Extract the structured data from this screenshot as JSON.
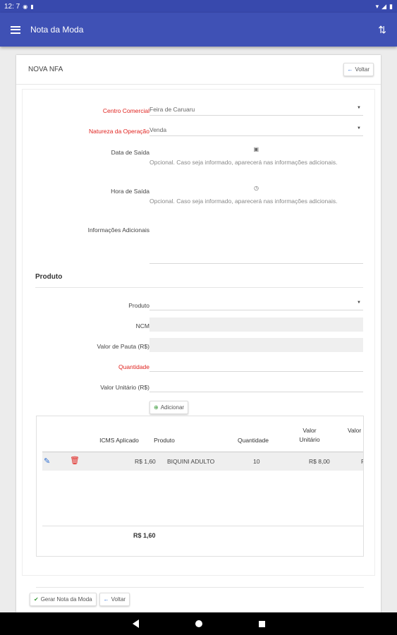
{
  "status": {
    "time": "12: 7"
  },
  "appbar": {
    "title": "Nota da Moda"
  },
  "card": {
    "title": "NOVA NFA",
    "back_label": "Voltar"
  },
  "form": {
    "centro_label": "Centro Comercial",
    "centro_value": "Feira de Caruaru",
    "natureza_label": "Natureza da Operação",
    "natureza_value": "Venda",
    "data_label": "Data de Saída",
    "data_help": "Opcional. Caso seja informado, aparecerá nas informações adicionais.",
    "hora_label": "Hora de Saída",
    "hora_help": "Opcional. Caso seja informado, aparecerá nas informações adicionais.",
    "info_label": "Informações Adicionais"
  },
  "produto_section": {
    "title": "Produto",
    "produto_label": "Produto",
    "ncm_label": "NCM",
    "pauta_label": "Valor de Pauta (R$)",
    "quantidade_label": "Quantidade",
    "unitario_label": "Valor Unitário (R$)",
    "add_label": "Adicionar"
  },
  "table": {
    "headers": [
      "ICMS Aplicado",
      "Produto",
      "Quantidade",
      "Valor Unitário",
      "Valor Pa"
    ],
    "rows": [
      {
        "icms": "R$ 1,60",
        "produto": "BIQUINI ADULTO",
        "quantidade": "10",
        "unitario": "R$ 8,00",
        "partial": "F"
      }
    ],
    "total": "R$ 1,60"
  },
  "footer": {
    "gerar_label": "Gerar Nota da Moda",
    "voltar_label": "Voltar"
  },
  "colors": {
    "primary": "#3f51b5",
    "required": "#e0231f"
  }
}
